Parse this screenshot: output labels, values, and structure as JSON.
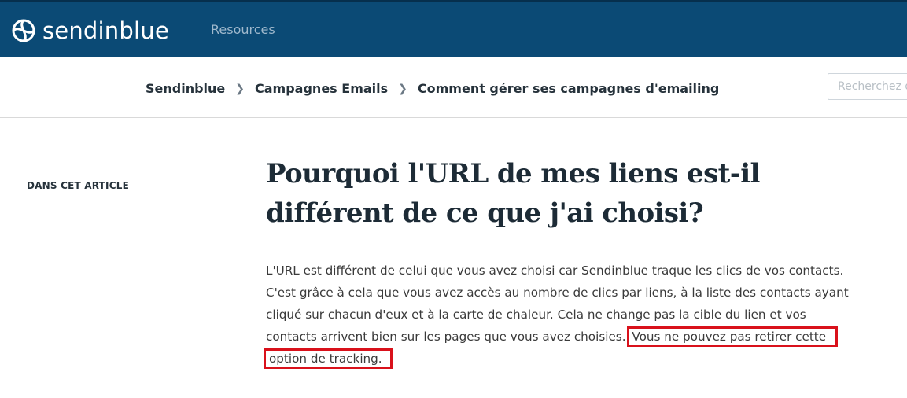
{
  "header": {
    "brand": "sendinblue",
    "nav_resources": "Resources",
    "colors": {
      "header_bg": "#0b4a75",
      "highlight": "#d9111b"
    }
  },
  "breadcrumb": {
    "items": [
      "Sendinblue",
      "Campagnes Emails",
      "Comment gérer ses campagnes d'emailing"
    ],
    "separator_icon": "chevron-right-icon"
  },
  "search": {
    "placeholder": "Recherchez d"
  },
  "sidebar": {
    "toc_label": "DANS CET ARTICLE"
  },
  "article": {
    "title_line1": "Pourquoi l'URL de mes liens est-il",
    "title_line2": "différent de ce que j'ai choisi?",
    "body_lines": [
      "L'URL est différent de celui que vous avez choisi car Sendinblue traque les clics de vos contacts.",
      "C'est grâce à cela que vous avez accès au nombre de clics par liens, à la liste des contacts ayant",
      "cliqué sur chacun d'eux et à la carte de chaleur. Cela ne change pas la cible du lien et vos",
      "contacts arrivent bien sur les pages que vous avez choisies."
    ],
    "highlight_part1": "Vous ne pouvez pas retirer cette",
    "highlight_part2": "option de tracking."
  }
}
